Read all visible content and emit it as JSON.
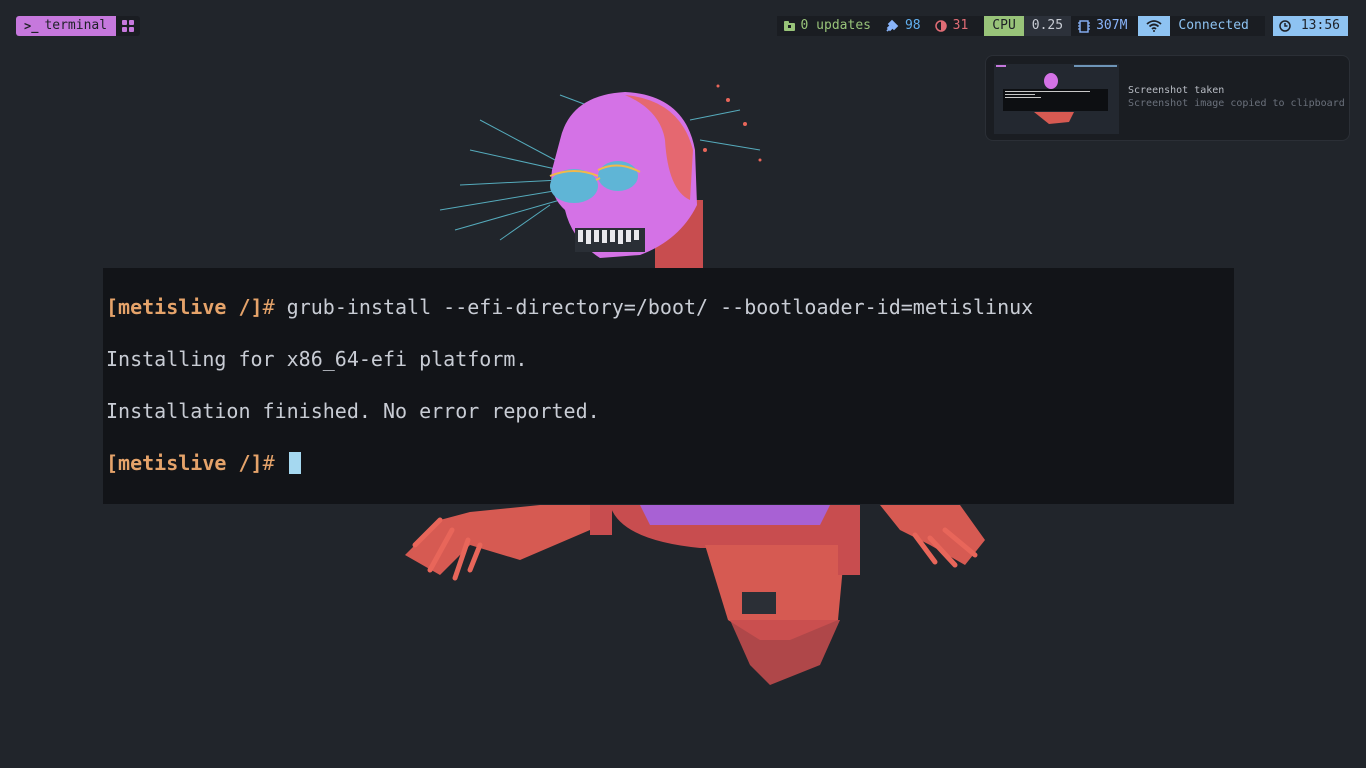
{
  "topbar": {
    "workspace_label": "terminal",
    "updates": "0 updates",
    "battery": "98",
    "brightness": "31",
    "cpu_label": "CPU",
    "cpu_value": "0.25",
    "memory": "307M",
    "network": "Connected",
    "clock": "13:56"
  },
  "notification": {
    "title": "Screenshot taken",
    "body": "Screenshot image copied to clipboard"
  },
  "terminal": {
    "prompt_open": "[",
    "prompt_user": "metislive",
    "prompt_path": " /",
    "prompt_close": "]",
    "prompt_hash": "#",
    "command": " grub-install --efi-directory=/boot/ --bootloader-id=metislinux",
    "output_1": "Installing for x86_64-efi platform.",
    "output_2": "Installation finished. No error reported."
  },
  "colors": {
    "background": "#21252b",
    "terminal_bg": "#121418",
    "workspace_accent": "#c678dd",
    "prompt": "#e5a36a",
    "cpu_accent": "#98c379",
    "net_accent": "#8ec3f2"
  },
  "icons": [
    "terminal-prompt-icon",
    "workspace-grid-icon",
    "package-icon",
    "plug-icon",
    "brightness-icon",
    "memory-chip-icon",
    "wifi-icon",
    "clock-icon"
  ]
}
